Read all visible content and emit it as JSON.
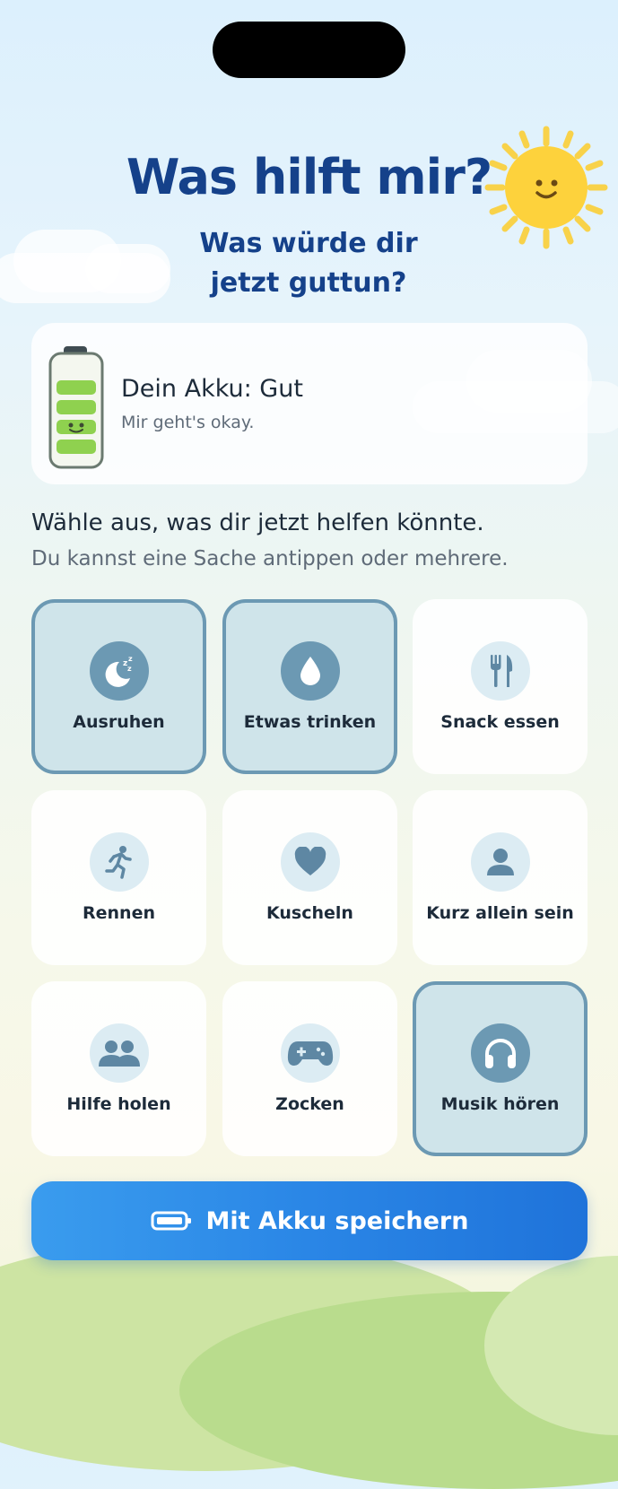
{
  "header": {
    "title": "Was hilft mir?",
    "subtitle": "Was würde dir jetzt guttun?"
  },
  "akku": {
    "title": "Dein Akku: Gut",
    "subtitle": "Mir geht's okay.",
    "level_segments_filled": 4,
    "level_segments_total": 4,
    "color": "#8fd14f"
  },
  "prompt": {
    "title": "Wähle aus, was dir jetzt helfen könnte.",
    "hint": "Du kannst eine Sache antippen oder mehrere."
  },
  "options": [
    {
      "label": "Ausruhen",
      "icon": "moon-sleep-icon",
      "selected": true
    },
    {
      "label": "Etwas trinken",
      "icon": "water-drop-icon",
      "selected": true
    },
    {
      "label": "Snack essen",
      "icon": "fork-knife-icon",
      "selected": false
    },
    {
      "label": "Rennen",
      "icon": "running-icon",
      "selected": false
    },
    {
      "label": "Kuscheln",
      "icon": "heart-icon",
      "selected": false
    },
    {
      "label": "Kurz allein sein",
      "icon": "person-icon",
      "selected": false
    },
    {
      "label": "Hilfe holen",
      "icon": "people-icon",
      "selected": false
    },
    {
      "label": "Zocken",
      "icon": "gamepad-icon",
      "selected": false
    },
    {
      "label": "Musik hören",
      "icon": "headphones-icon",
      "selected": true
    }
  ],
  "save_button": {
    "label": "Mit Akku speichern",
    "icon": "battery-icon"
  },
  "colors": {
    "title": "#15418a",
    "selected_border": "#6c99b3",
    "selected_bg": "#cfe4ea",
    "button": "#2a86e6",
    "icon_color": "#5e87a3"
  }
}
